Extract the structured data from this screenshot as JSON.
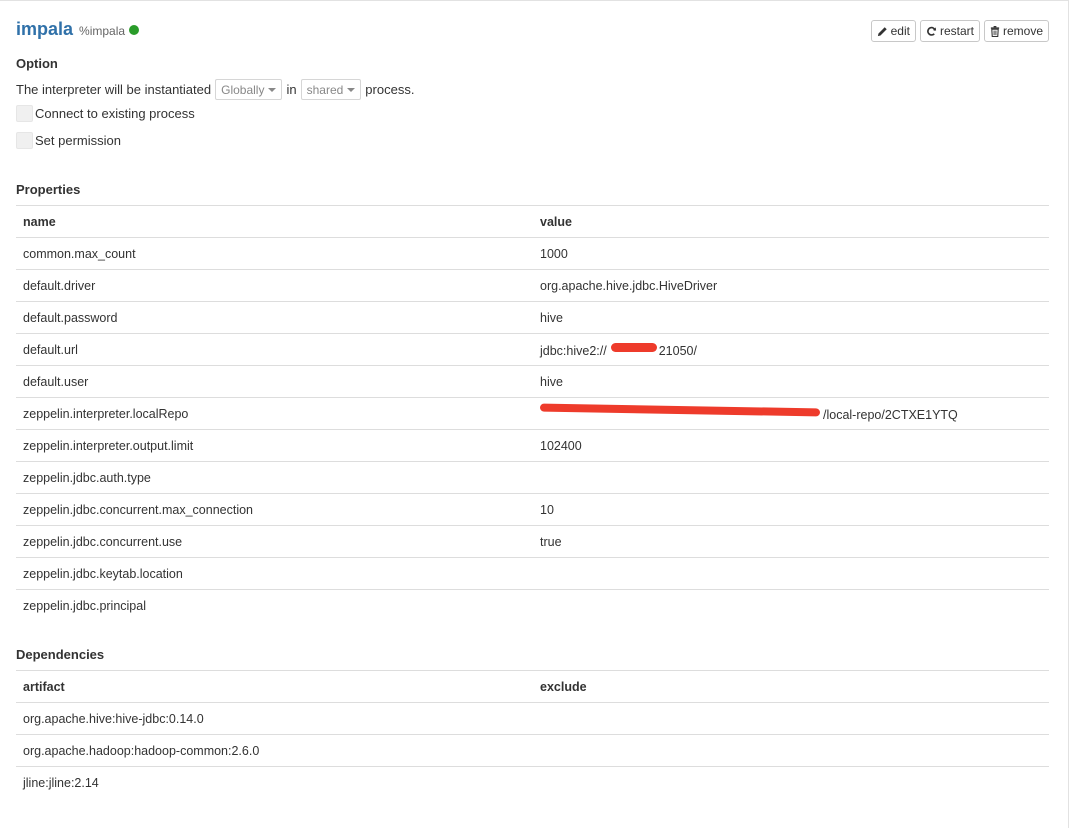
{
  "interpreter": {
    "name": "impala",
    "tag": "%impala",
    "status_color": "#2a9c2a"
  },
  "actions": [
    {
      "label": "edit",
      "icon": "pencil-icon"
    },
    {
      "label": "restart",
      "icon": "refresh-icon"
    },
    {
      "label": "remove",
      "icon": "trash-icon"
    }
  ],
  "option": {
    "title": "Option",
    "text_before": "The interpreter will be instantiated",
    "mode_value": "Globally",
    "text_in": "in",
    "process_value": "shared",
    "text_after": "process.",
    "connect_label": "Connect to existing process",
    "permission_label": "Set permission"
  },
  "properties": {
    "title": "Properties",
    "headers": {
      "name": "name",
      "value": "value"
    },
    "rows": [
      {
        "name": "common.max_count",
        "value": "1000"
      },
      {
        "name": "default.driver",
        "value": "org.apache.hive.jdbc.HiveDriver"
      },
      {
        "name": "default.password",
        "value": "hive"
      },
      {
        "name": "default.url",
        "value": "jdbc:hive2://"
      },
      {
        "name": "default.user",
        "value": "hive"
      },
      {
        "name": "zeppelin.interpreter.localRepo",
        "value": ""
      },
      {
        "name": "zeppelin.interpreter.output.limit",
        "value": "102400"
      },
      {
        "name": "zeppelin.jdbc.auth.type",
        "value": ""
      },
      {
        "name": "zeppelin.jdbc.concurrent.max_connection",
        "value": "10"
      },
      {
        "name": "zeppelin.jdbc.concurrent.use",
        "value": "true"
      },
      {
        "name": "zeppelin.jdbc.keytab.location",
        "value": ""
      },
      {
        "name": "zeppelin.jdbc.principal",
        "value": ""
      }
    ],
    "url_suffix": "21050/",
    "repo_suffix": "/local-repo/2CTXE1YTQ"
  },
  "dependencies": {
    "title": "Dependencies",
    "headers": {
      "artifact": "artifact",
      "exclude": "exclude"
    },
    "rows": [
      {
        "artifact": "org.apache.hive:hive-jdbc:0.14.0",
        "exclude": ""
      },
      {
        "artifact": "org.apache.hadoop:hadoop-common:2.6.0",
        "exclude": ""
      },
      {
        "artifact": "jline:jline:2.14",
        "exclude": ""
      }
    ]
  },
  "redaction_color": "#ee3b2b"
}
